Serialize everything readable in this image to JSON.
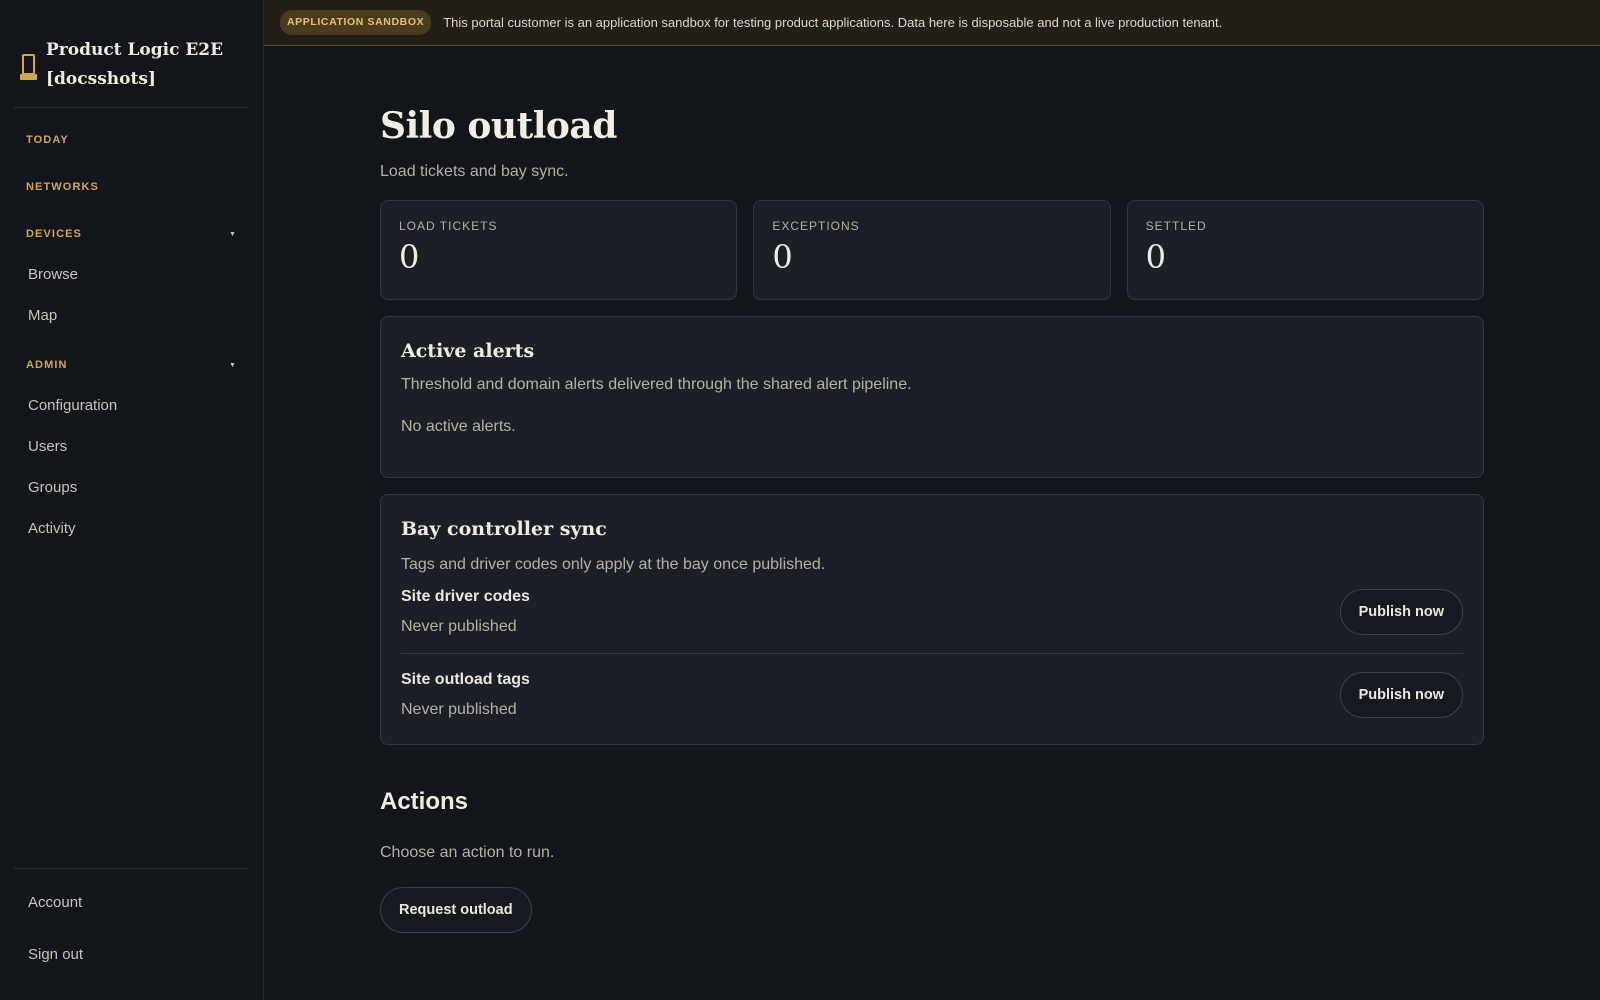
{
  "sidebar": {
    "brand_title": "Product Logic E2E [docsshots]",
    "brand_icon": "silo-icon",
    "sections": {
      "today": "TODAY",
      "networks": "NETWORKS",
      "devices": "DEVICES",
      "admin": "ADMIN"
    },
    "devices_items": [
      "Browse",
      "Map"
    ],
    "admin_items": [
      "Configuration",
      "Users",
      "Groups",
      "Activity"
    ],
    "bottom_items": [
      "Account",
      "Sign out"
    ]
  },
  "banner": {
    "badge": "APPLICATION SANDBOX",
    "text": "This portal customer is an application sandbox for testing product applications. Data here is disposable and not a live production tenant."
  },
  "page": {
    "title": "Silo outload",
    "subtitle": "Load tickets and bay sync."
  },
  "stats": [
    {
      "label": "LOAD TICKETS",
      "value": "0"
    },
    {
      "label": "EXCEPTIONS",
      "value": "0"
    },
    {
      "label": "SETTLED",
      "value": "0"
    }
  ],
  "alerts": {
    "title": "Active alerts",
    "description": "Threshold and domain alerts delivered through the shared alert pipeline.",
    "empty": "No active alerts."
  },
  "sync": {
    "title": "Bay controller sync",
    "description": "Tags and driver codes only apply at the bay once published.",
    "rows": [
      {
        "name": "Site driver codes",
        "status": "Never published",
        "button": "Publish now"
      },
      {
        "name": "Site outload tags",
        "status": "Never published",
        "button": "Publish now"
      }
    ]
  },
  "actions": {
    "title": "Actions",
    "description": "Choose an action to run.",
    "button": "Request outload"
  },
  "colors": {
    "accent": "#d4a64a",
    "background": "#121519",
    "card": "#1b2027",
    "banner": "#231f17"
  }
}
